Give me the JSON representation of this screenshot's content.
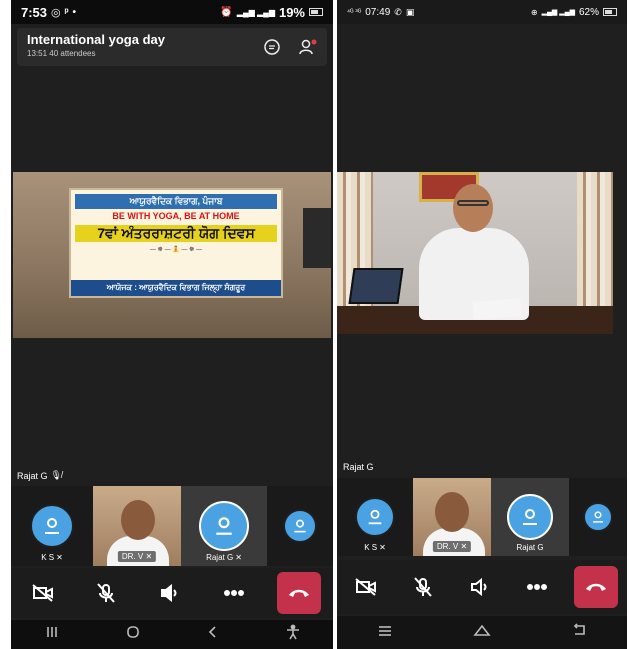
{
  "left_phone": {
    "status": {
      "time": "7:53",
      "signal": "…….ıl ….ıl",
      "battery": "19%"
    },
    "meeting": {
      "title": "International yoga day",
      "subtitle": "13:51  40 attendees"
    },
    "banner": {
      "line1": "ਆਯੁਰਵੈਦਿਕ ਵਿਭਾਗ, ਪੰਜਾਬ",
      "line2": "BE WITH YOGA, BE AT HOME",
      "line3": "7ਵਾਂ ਅੰਤਰਰਾਸ਼ਟਰੀ ਯੋਗ ਦਿਵਸ",
      "footer": "ਆਯੋਜਕ : ਆਯੁਰਵੈਦਿਕ ਵਿਭਾਗ ਜਿਲ੍ਹਾ ਸੰਗਰੂਰ"
    },
    "speaker_label": "Rajat G",
    "participants": [
      {
        "name": "K S"
      },
      {
        "name": "DR. V"
      },
      {
        "name": "Rajat G"
      }
    ]
  },
  "right_phone": {
    "status": {
      "time": "07:49",
      "battery": "62%"
    },
    "speaker_label": "Rajat G",
    "participants": [
      {
        "name": "K S"
      },
      {
        "name": "DR. V"
      },
      {
        "name": "Rajat G"
      }
    ]
  },
  "colors": {
    "accent_avatar": "#4aa2e2",
    "hangup": "#c4314b",
    "background": "#1f1f1f"
  }
}
